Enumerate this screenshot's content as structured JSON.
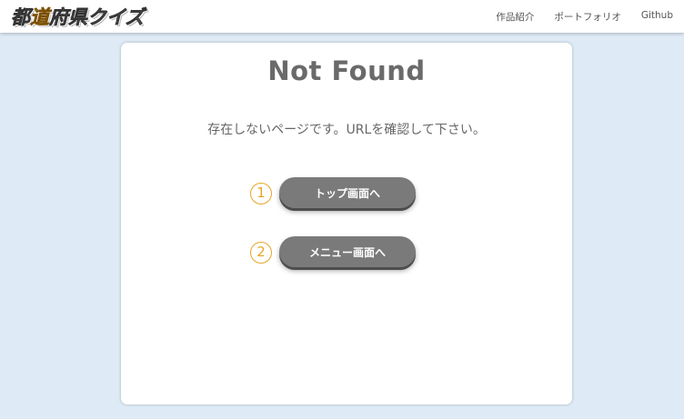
{
  "header": {
    "logo_part1": "都",
    "logo_accent": "道",
    "logo_part2": "府県クイズ",
    "nav": [
      "作品紹介",
      "ポートフォリオ",
      "Github"
    ]
  },
  "main": {
    "title": "Not Found",
    "message": "存在しないページです。URLを確認して下さい。",
    "buttons": [
      {
        "number": "1",
        "label": "トップ画面へ"
      },
      {
        "number": "2",
        "label": "メニュー画面へ"
      }
    ]
  },
  "colors": {
    "background": "#deebf7",
    "logo_accent": "#e49a18",
    "number_circle": "#e8a526",
    "button": "#7a7a7a"
  }
}
